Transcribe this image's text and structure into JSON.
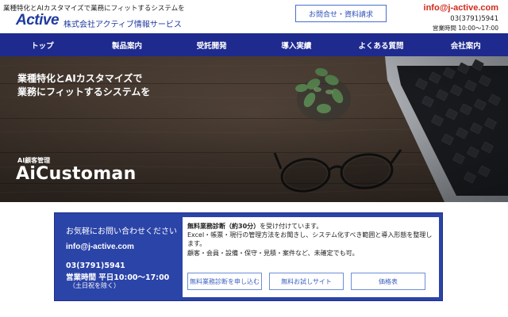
{
  "header": {
    "tagline": "業種特化とAIカスタマイズで業務にフィットするシステムを",
    "logo_text": "Active",
    "company_name": "株式会社アクティブ情報サービス",
    "inquiry_button": "お問合せ・資料請求",
    "email": "info@j-active.com",
    "phone": "03(3791)5941",
    "hours": "営業時間 10:00〜17:00"
  },
  "nav": {
    "items": [
      {
        "label": "トップ"
      },
      {
        "label": "製品案内"
      },
      {
        "label": "受託開発"
      },
      {
        "label": "導入実績"
      },
      {
        "label": "よくある質問"
      },
      {
        "label": "会社案内"
      }
    ]
  },
  "hero": {
    "line1": "業種特化とAIカスタマイズで",
    "line2": "業務にフィットするシステムを",
    "subtitle": "AI顧客管理",
    "title": "AiCustoman"
  },
  "contact": {
    "heading": "お気軽にお問い合わせください",
    "email": "info@j-active.com",
    "phone": "03(3791)5941",
    "hours": "営業時間 平日10:00〜17:00",
    "holiday": "（土日祝を除く）",
    "panel": {
      "line1_bold": "無料業務診断（約30分）",
      "line1_rest": "を受け付けています。",
      "line2": "Excel・帳票・現行の管理方法をお聞きし、システム化すべき範囲と導入形態を整理します。",
      "line3": "顧客・会員・設備・保守・見積・案件など、未確定でも可。"
    },
    "buttons": [
      {
        "label": "無料業務診断を申し込む"
      },
      {
        "label": "無料お試しサイト"
      },
      {
        "label": "価格表"
      }
    ]
  }
}
